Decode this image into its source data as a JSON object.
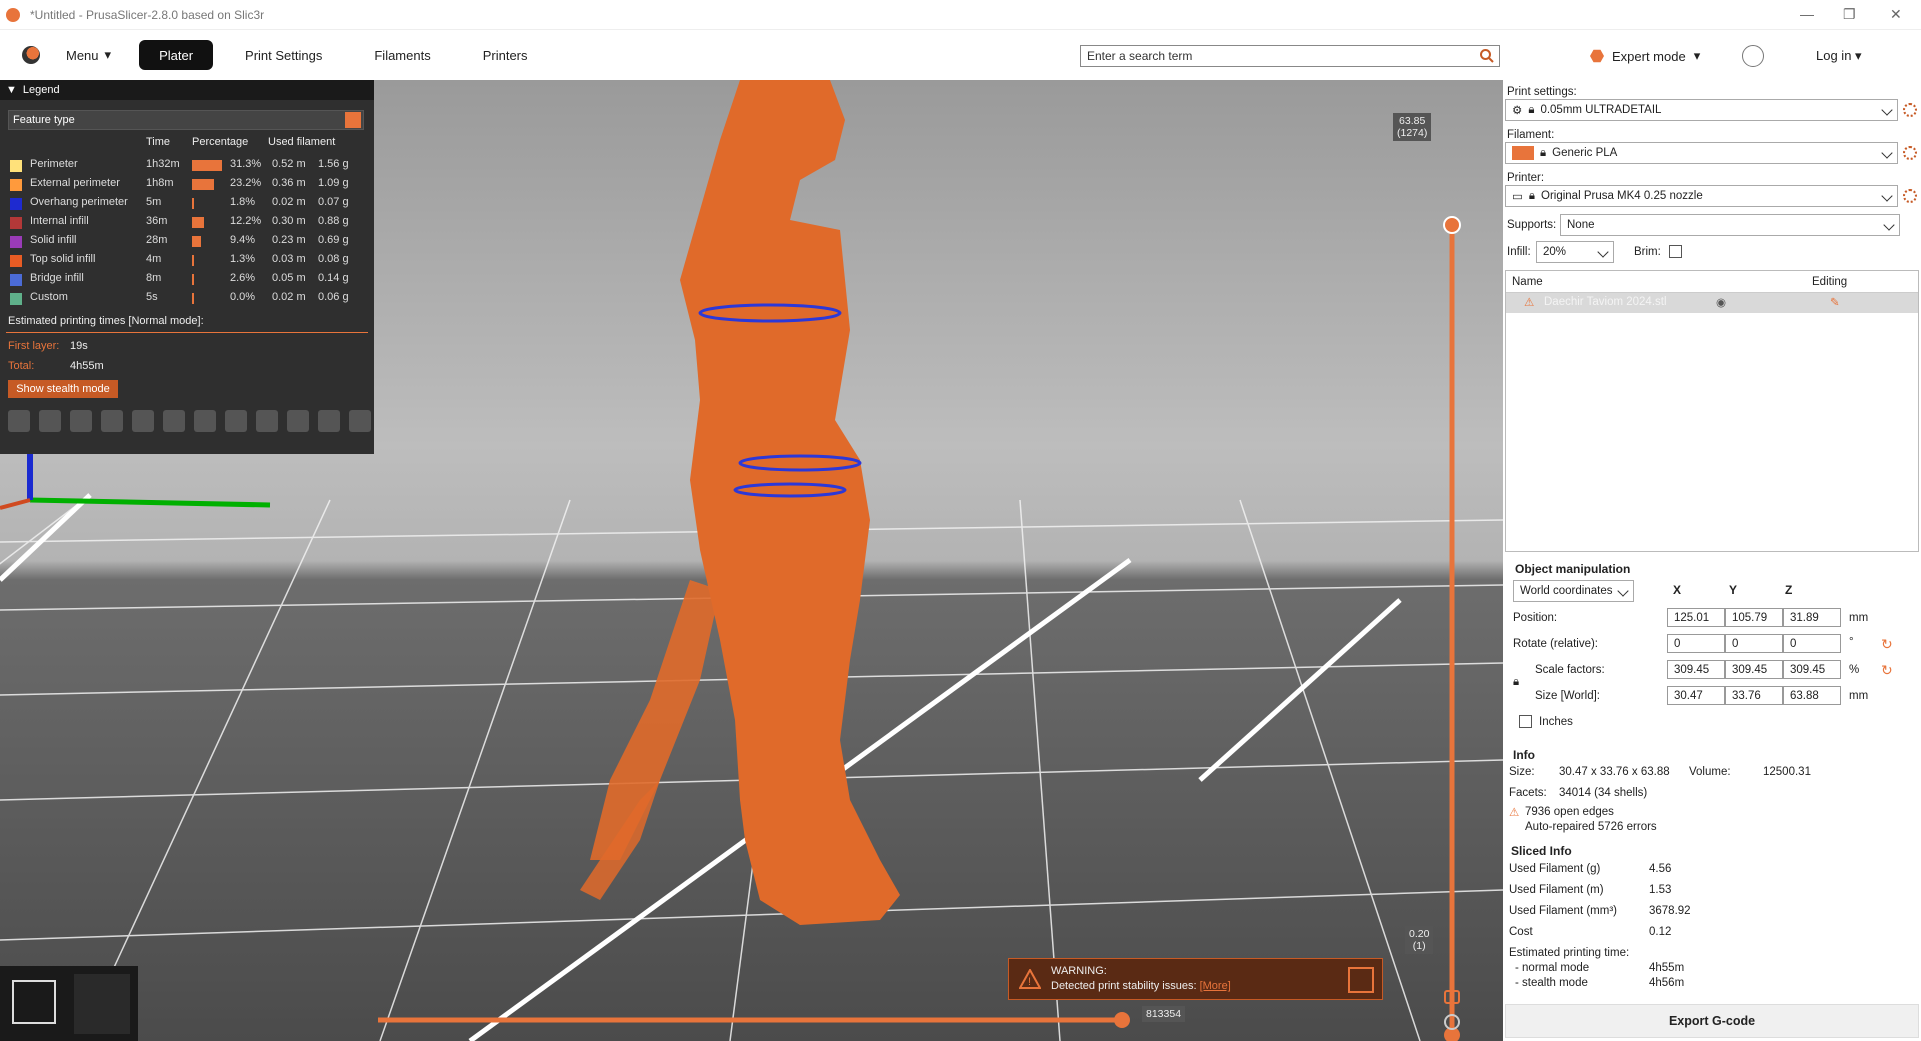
{
  "window": {
    "title": "*Untitled - PrusaSlicer-2.8.0 based on Slic3r"
  },
  "menubar": {
    "menu_label": "Menu",
    "tabs": [
      {
        "label": "Plater",
        "active": true
      },
      {
        "label": "Print Settings"
      },
      {
        "label": "Filaments"
      },
      {
        "label": "Printers"
      }
    ],
    "search_placeholder": "Enter a search term",
    "mode_label": "Expert mode",
    "login_label": "Log in"
  },
  "legend": {
    "title": "Legend",
    "view_type": "Feature type",
    "columns": [
      "Time",
      "Percentage",
      "Used filament"
    ],
    "rows": [
      {
        "name": "Perimeter",
        "time": "1h32m",
        "pct": "31.3%",
        "pct_value": 31.3,
        "len": "0.52 m",
        "weight": "1.56 g",
        "color": "#ffe17a"
      },
      {
        "name": "External perimeter",
        "time": "1h8m",
        "pct": "23.2%",
        "pct_value": 23.2,
        "len": "0.36 m",
        "weight": "1.09 g",
        "color": "#ff9a3c"
      },
      {
        "name": "Overhang perimeter",
        "time": "5m",
        "pct": "1.8%",
        "pct_value": 1.8,
        "len": "0.02 m",
        "weight": "0.07 g",
        "color": "#1e2ad0"
      },
      {
        "name": "Internal infill",
        "time": "36m",
        "pct": "12.2%",
        "pct_value": 12.2,
        "len": "0.30 m",
        "weight": "0.88 g",
        "color": "#b33838"
      },
      {
        "name": "Solid infill",
        "time": "28m",
        "pct": "9.4%",
        "pct_value": 9.4,
        "len": "0.23 m",
        "weight": "0.69 g",
        "color": "#9a3bb8"
      },
      {
        "name": "Top solid infill",
        "time": "4m",
        "pct": "1.3%",
        "pct_value": 1.3,
        "len": "0.03 m",
        "weight": "0.08 g",
        "color": "#e85c24"
      },
      {
        "name": "Bridge infill",
        "time": "8m",
        "pct": "2.6%",
        "pct_value": 2.6,
        "len": "0.05 m",
        "weight": "0.14 g",
        "color": "#4b6bd6"
      },
      {
        "name": "Custom",
        "time": "5s",
        "pct": "0.0%",
        "pct_value": 0.0,
        "len": "0.02 m",
        "weight": "0.06 g",
        "color": "#5fb08a"
      }
    ],
    "estimated_label": "Estimated printing times [Normal mode]:",
    "first_layer_label": "First layer:",
    "first_layer_value": "19s",
    "total_label": "Total:",
    "total_value": "4h55m",
    "stealth_button": "Show stealth mode"
  },
  "viewport": {
    "layer_top_value": "63.85",
    "layer_top_index": "(1274)",
    "layer_bottom_value": "0.20",
    "layer_bottom_index": "(1)",
    "move_value": "813354",
    "warning_title": "WARNING:",
    "warning_text": "Detected print stability issues:",
    "warning_link": "[More]"
  },
  "sidebar": {
    "print_settings_label": "Print settings:",
    "print_settings_value": "0.05mm ULTRADETAIL",
    "filament_label": "Filament:",
    "filament_value": "Generic PLA",
    "filament_color": "#e8743b",
    "printer_label": "Printer:",
    "printer_value": "Original Prusa MK4 0.25 nozzle",
    "supports_label": "Supports:",
    "supports_value": "None",
    "infill_label": "Infill:",
    "infill_value": "20%",
    "brim_label": "Brim:",
    "list_col_name": "Name",
    "list_col_editing": "Editing",
    "object_name": "Daechir Taviom 2024.stl"
  },
  "object_manipulation": {
    "title": "Object manipulation",
    "coords": "World coordinates",
    "axis_x": "X",
    "axis_y": "Y",
    "axis_z": "Z",
    "position_label": "Position:",
    "position": [
      "125.01",
      "105.79",
      "31.89"
    ],
    "position_unit": "mm",
    "rotate_label": "Rotate (relative):",
    "rotate": [
      "0",
      "0",
      "0"
    ],
    "rotate_unit": "°",
    "scale_label": "Scale factors:",
    "scale": [
      "309.45",
      "309.45",
      "309.45"
    ],
    "scale_unit": "%",
    "size_label": "Size [World]:",
    "size": [
      "30.47",
      "33.76",
      "63.88"
    ],
    "size_unit": "mm",
    "inches_label": "Inches"
  },
  "info": {
    "title": "Info",
    "size_label": "Size:",
    "size_value": "30.47 x 33.76 x 63.88",
    "volume_label": "Volume:",
    "volume_value": "12500.31",
    "facets_label": "Facets:",
    "facets_value": "34014 (34 shells)",
    "open_edges": "7936 open edges",
    "auto_repaired": "Auto-repaired 5726 errors"
  },
  "sliced_info": {
    "title": "Sliced Info",
    "rows": [
      {
        "label": "Used Filament (g)",
        "value": "4.56"
      },
      {
        "label": "Used Filament (m)",
        "value": "1.53"
      },
      {
        "label": "Used Filament (mm³)",
        "value": "3678.92"
      },
      {
        "label": "Cost",
        "value": "0.12"
      }
    ],
    "est_label": "Estimated printing time:",
    "normal_label": "- normal mode",
    "normal_value": "4h55m",
    "stealth_label": "- stealth mode",
    "stealth_value": "4h56m"
  },
  "export_button": "Export G-code"
}
